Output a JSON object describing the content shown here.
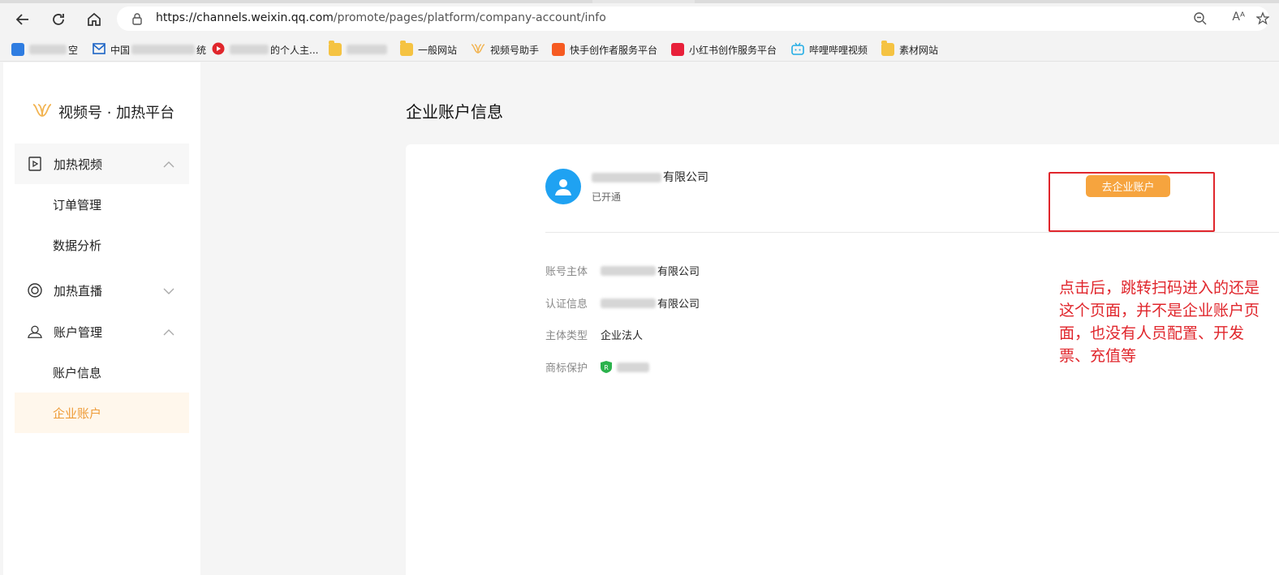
{
  "browser": {
    "url_host": "https://channels.weixin.qq.com",
    "url_path": "/promote/pages/platform/company-account/info",
    "read_aloud": "Aᴬ"
  },
  "bookmarks": [
    {
      "label": "空",
      "icon": "blue-square-icon",
      "color": "#2f7de1"
    },
    {
      "label": "中国",
      "suffix": "统",
      "icon": "mail-icon",
      "color": "#1b63c5"
    },
    {
      "label": "的个人主...",
      "icon": "red-play-icon",
      "color": "#e0262c"
    },
    {
      "label": "",
      "icon": "folder-icon"
    },
    {
      "label": "一般网站",
      "icon": "folder-icon"
    },
    {
      "label": "视频号助手",
      "icon": "channels-logo-icon"
    },
    {
      "label": "快手创作者服务平台",
      "icon": "kuaishou-icon",
      "color": "#f65b22"
    },
    {
      "label": "小红书创作服务平台",
      "icon": "xiaohongshu-icon",
      "color": "#e8203a"
    },
    {
      "label": "哔哩哔哩视频",
      "icon": "bilibili-icon",
      "color": "#23ade5"
    },
    {
      "label": "素材网站",
      "icon": "folder-icon"
    }
  ],
  "sidebar": {
    "brand": "视频号 · 加热平台",
    "groups": [
      {
        "label": "加热视频",
        "icon": "play-box-icon",
        "expanded": true,
        "items": [
          "订单管理",
          "数据分析"
        ]
      },
      {
        "label": "加热直播",
        "icon": "live-circle-icon",
        "expanded": false,
        "items": []
      },
      {
        "label": "账户管理",
        "icon": "user-icon",
        "expanded": true,
        "items": [
          "账户信息",
          "企业账户"
        ]
      }
    ],
    "selected_item": "企业账户"
  },
  "main": {
    "title": "企业账户信息",
    "company_name": "有限公司",
    "status": "已开通",
    "go_button": "去企业账户",
    "fields": [
      {
        "key": "账号主体",
        "value": "有限公司"
      },
      {
        "key": "认证信息",
        "value": "有限公司"
      },
      {
        "key": "主体类型",
        "value": "企业法人"
      },
      {
        "key": "商标保护",
        "value": ""
      }
    ]
  },
  "annotation": {
    "text": "点击后，跳转扫码进入的还是这个页面，并不是企业账户页面，也没有人员配置、开发票、充值等"
  },
  "colors": {
    "accent": "#f6a43e",
    "selected_text": "#ee9b37",
    "avatar": "#1fa2f2",
    "annotation": "#e0262c"
  }
}
